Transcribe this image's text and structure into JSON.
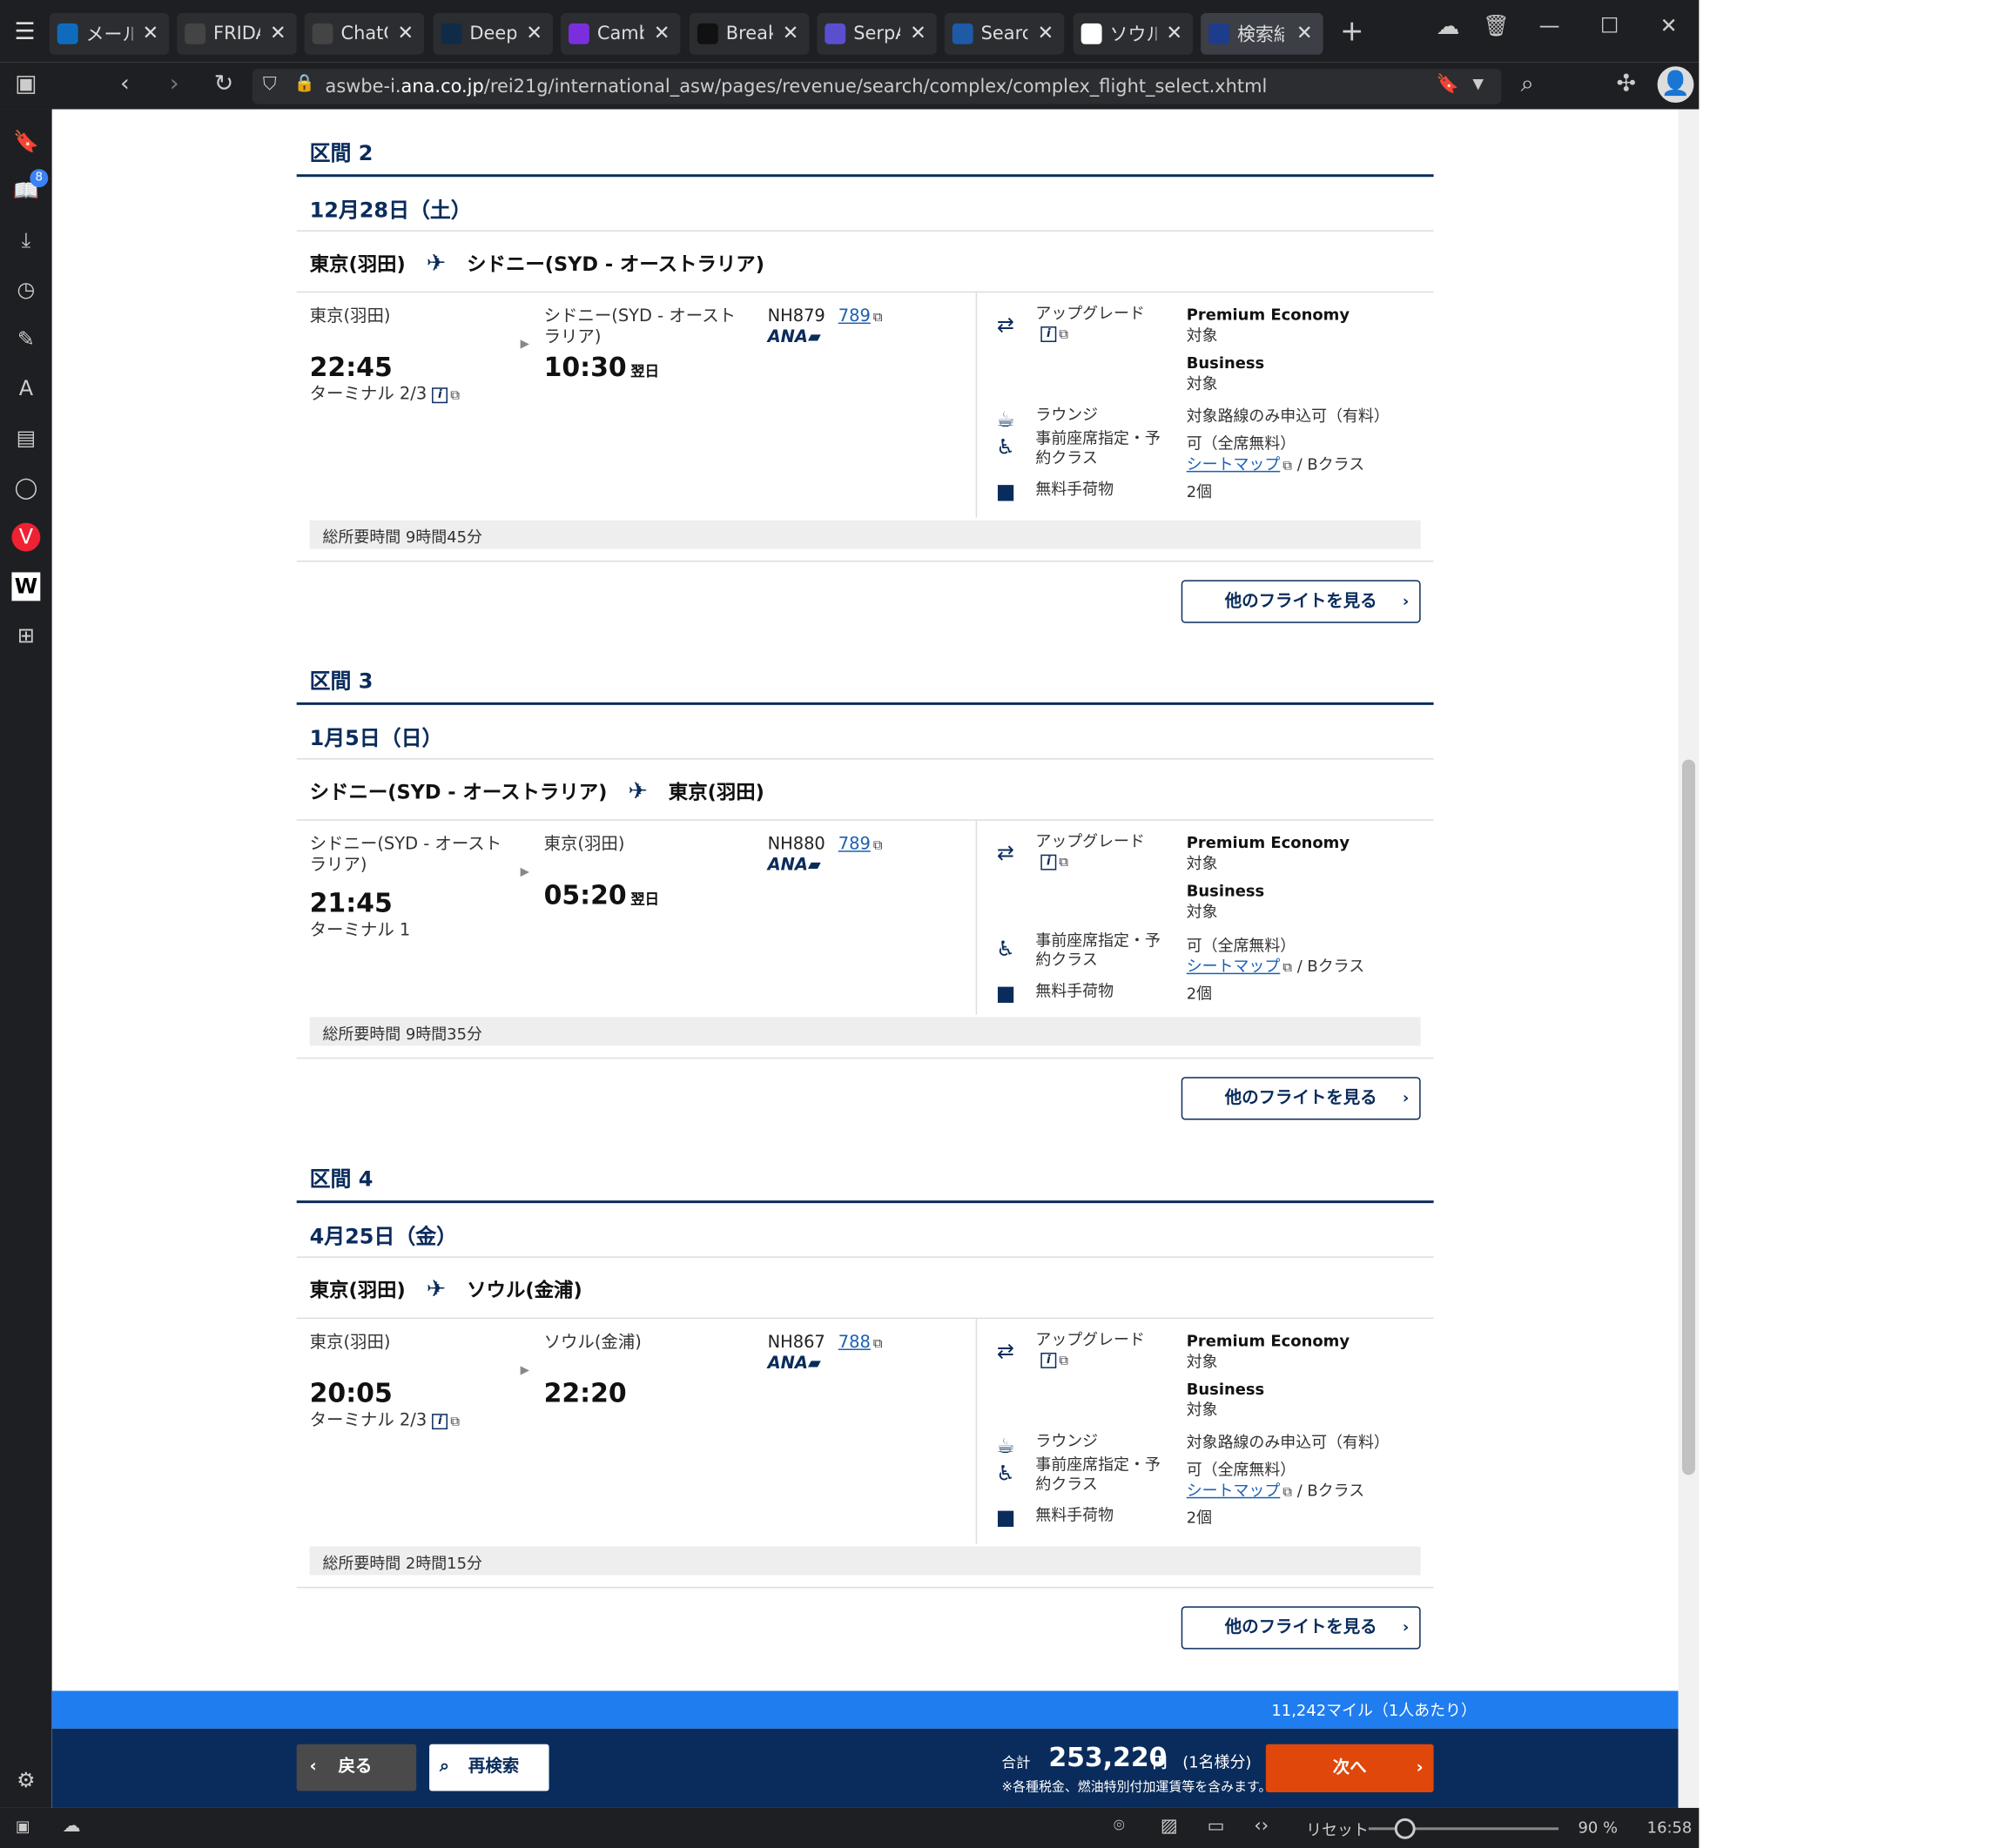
{
  "browser": {
    "tabs": [
      {
        "label": "メール",
        "icon": "outlook-icon",
        "color": "#0f6cbd"
      },
      {
        "label": "FRIDA",
        "icon": "speaker-icon",
        "color": "#444444"
      },
      {
        "label": "ChatG",
        "icon": "chatgpt-icon",
        "color": "#444444"
      },
      {
        "label": "DeepL",
        "icon": "deepl-icon",
        "color": "#0f2b46"
      },
      {
        "label": "Camb",
        "icon": "camb-icon",
        "color": "#7b2fdc"
      },
      {
        "label": "Break",
        "icon": "b-icon",
        "color": "#111111"
      },
      {
        "label": "SerpA",
        "icon": "serp-icon",
        "color": "#5a4fcf"
      },
      {
        "label": "Searc",
        "icon": "search-site-icon",
        "color": "#1e5aa8"
      },
      {
        "label": "ソウル",
        "icon": "google-icon",
        "color": "#ffffff"
      },
      {
        "label": "検索結",
        "icon": "ana-icon",
        "color": "#1e3c8c"
      }
    ],
    "url_host_prefix": "aswbe-i.",
    "url_host": "ana.co.jp",
    "url_path": "/rei21g/international_asw/pages/revenue/search/complex/complex_flight_select.xhtml",
    "sidebar_badge": "8",
    "status": {
      "reset": "リセット",
      "zoom": "90 %",
      "time": "16:58"
    }
  },
  "segments": [
    {
      "title": "区間 2",
      "date": "12月28日（土）",
      "route_from": "東京(羽田)",
      "route_to": "シドニー(SYD - オーストラリア)",
      "dep_city": "東京(羽田)",
      "dep_time": "22:45",
      "dep_terminal": "ターミナル 2/3",
      "arr_city": "シドニー(SYD - オーストラリア)",
      "arr_time": "10:30",
      "arr_nextday": "翌日",
      "flight_no": "NH879",
      "aircraft": "789",
      "airline": "ANA",
      "upgrade_label": "アップグレード",
      "upgrade_pe": "Premium Economy",
      "upgrade_pe_val": "対象",
      "upgrade_bus": "Business",
      "upgrade_bus_val": "対象",
      "lounge_label": "ラウンジ",
      "lounge_val": "対象路線のみ申込可（有料）",
      "seat_label": "事前座席指定・予約クラス",
      "seat_val": "可（全席無料）",
      "seatmap_link": "シートマップ",
      "seat_class": "/ Bクラス",
      "baggage_label": "無料手荷物",
      "baggage_val": "2個",
      "total_time": "総所要時間 9時間45分",
      "other_btn": "他のフライトを見る"
    },
    {
      "title": "区間 3",
      "date": "1月5日（日）",
      "route_from": "シドニー(SYD - オーストラリア)",
      "route_to": "東京(羽田)",
      "dep_city": "シドニー(SYD - オーストラリア)",
      "dep_time": "21:45",
      "dep_terminal": "ターミナル 1",
      "arr_city": "東京(羽田)",
      "arr_time": "05:20",
      "arr_nextday": "翌日",
      "flight_no": "NH880",
      "aircraft": "789",
      "airline": "ANA",
      "upgrade_label": "アップグレード",
      "upgrade_pe": "Premium Economy",
      "upgrade_pe_val": "対象",
      "upgrade_bus": "Business",
      "upgrade_bus_val": "対象",
      "seat_label": "事前座席指定・予約クラス",
      "seat_val": "可（全席無料）",
      "seatmap_link": "シートマップ",
      "seat_class": "/ Bクラス",
      "baggage_label": "無料手荷物",
      "baggage_val": "2個",
      "total_time": "総所要時間 9時間35分",
      "other_btn": "他のフライトを見る"
    },
    {
      "title": "区間 4",
      "date": "4月25日（金）",
      "route_from": "東京(羽田)",
      "route_to": "ソウル(金浦)",
      "dep_city": "東京(羽田)",
      "dep_time": "20:05",
      "dep_terminal": "ターミナル 2/3",
      "arr_city": "ソウル(金浦)",
      "arr_time": "22:20",
      "flight_no": "NH867",
      "aircraft": "788",
      "airline": "ANA",
      "upgrade_label": "アップグレード",
      "upgrade_pe": "Premium Economy",
      "upgrade_pe_val": "対象",
      "upgrade_bus": "Business",
      "upgrade_bus_val": "対象",
      "lounge_label": "ラウンジ",
      "lounge_val": "対象路線のみ申込可（有料）",
      "seat_label": "事前座席指定・予約クラス",
      "seat_val": "可（全席無料）",
      "seatmap_link": "シートマップ",
      "seat_class": "/ Bクラス",
      "baggage_label": "無料手荷物",
      "baggage_val": "2個",
      "total_time": "総所要時間 2時間15分",
      "other_btn": "他のフライトを見る"
    }
  ],
  "footer": {
    "miles": "11,242マイル（1人あたり）",
    "back": "戻る",
    "research": "再検索",
    "total_label": "合計",
    "total_amount": "253,220",
    "yen": "円",
    "per": "(1名様分)",
    "note": "※各種税金、燃油特別付加運賃等を含みます。",
    "next": "次へ"
  },
  "colors": {
    "navy": "#0a2c5c",
    "blue": "#1f7df0",
    "orange": "#e0470a",
    "link": "#1a5fb4"
  }
}
